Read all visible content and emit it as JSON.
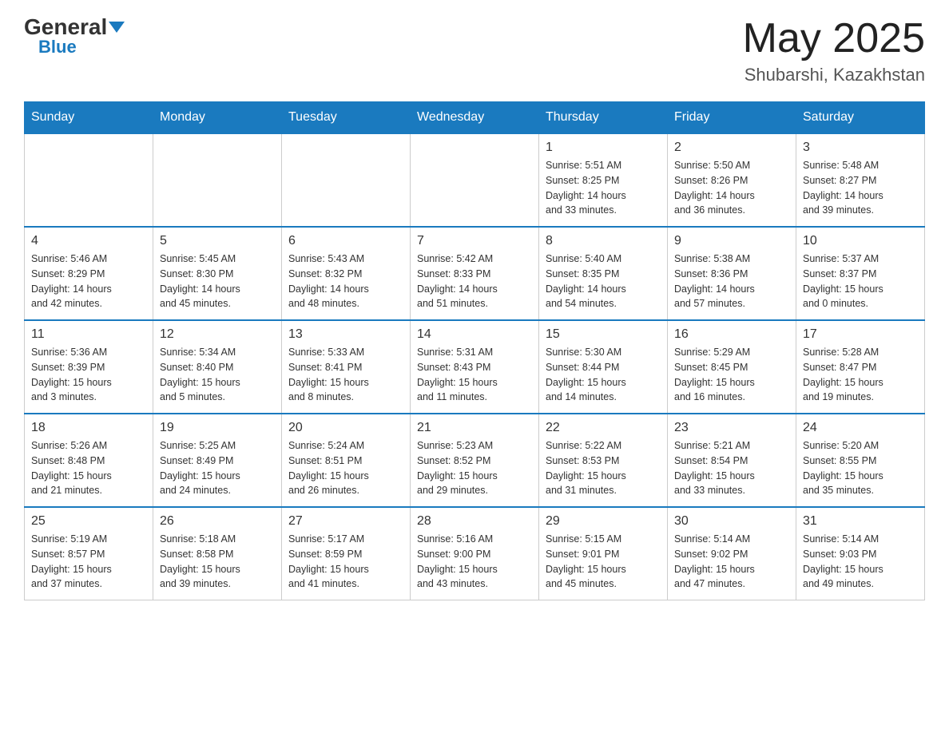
{
  "header": {
    "logo_general": "General",
    "logo_blue": "Blue",
    "month_year": "May 2025",
    "location": "Shubarshi, Kazakhstan"
  },
  "days_of_week": [
    "Sunday",
    "Monday",
    "Tuesday",
    "Wednesday",
    "Thursday",
    "Friday",
    "Saturday"
  ],
  "weeks": [
    [
      {
        "day": "",
        "info": ""
      },
      {
        "day": "",
        "info": ""
      },
      {
        "day": "",
        "info": ""
      },
      {
        "day": "",
        "info": ""
      },
      {
        "day": "1",
        "info": "Sunrise: 5:51 AM\nSunset: 8:25 PM\nDaylight: 14 hours\nand 33 minutes."
      },
      {
        "day": "2",
        "info": "Sunrise: 5:50 AM\nSunset: 8:26 PM\nDaylight: 14 hours\nand 36 minutes."
      },
      {
        "day": "3",
        "info": "Sunrise: 5:48 AM\nSunset: 8:27 PM\nDaylight: 14 hours\nand 39 minutes."
      }
    ],
    [
      {
        "day": "4",
        "info": "Sunrise: 5:46 AM\nSunset: 8:29 PM\nDaylight: 14 hours\nand 42 minutes."
      },
      {
        "day": "5",
        "info": "Sunrise: 5:45 AM\nSunset: 8:30 PM\nDaylight: 14 hours\nand 45 minutes."
      },
      {
        "day": "6",
        "info": "Sunrise: 5:43 AM\nSunset: 8:32 PM\nDaylight: 14 hours\nand 48 minutes."
      },
      {
        "day": "7",
        "info": "Sunrise: 5:42 AM\nSunset: 8:33 PM\nDaylight: 14 hours\nand 51 minutes."
      },
      {
        "day": "8",
        "info": "Sunrise: 5:40 AM\nSunset: 8:35 PM\nDaylight: 14 hours\nand 54 minutes."
      },
      {
        "day": "9",
        "info": "Sunrise: 5:38 AM\nSunset: 8:36 PM\nDaylight: 14 hours\nand 57 minutes."
      },
      {
        "day": "10",
        "info": "Sunrise: 5:37 AM\nSunset: 8:37 PM\nDaylight: 15 hours\nand 0 minutes."
      }
    ],
    [
      {
        "day": "11",
        "info": "Sunrise: 5:36 AM\nSunset: 8:39 PM\nDaylight: 15 hours\nand 3 minutes."
      },
      {
        "day": "12",
        "info": "Sunrise: 5:34 AM\nSunset: 8:40 PM\nDaylight: 15 hours\nand 5 minutes."
      },
      {
        "day": "13",
        "info": "Sunrise: 5:33 AM\nSunset: 8:41 PM\nDaylight: 15 hours\nand 8 minutes."
      },
      {
        "day": "14",
        "info": "Sunrise: 5:31 AM\nSunset: 8:43 PM\nDaylight: 15 hours\nand 11 minutes."
      },
      {
        "day": "15",
        "info": "Sunrise: 5:30 AM\nSunset: 8:44 PM\nDaylight: 15 hours\nand 14 minutes."
      },
      {
        "day": "16",
        "info": "Sunrise: 5:29 AM\nSunset: 8:45 PM\nDaylight: 15 hours\nand 16 minutes."
      },
      {
        "day": "17",
        "info": "Sunrise: 5:28 AM\nSunset: 8:47 PM\nDaylight: 15 hours\nand 19 minutes."
      }
    ],
    [
      {
        "day": "18",
        "info": "Sunrise: 5:26 AM\nSunset: 8:48 PM\nDaylight: 15 hours\nand 21 minutes."
      },
      {
        "day": "19",
        "info": "Sunrise: 5:25 AM\nSunset: 8:49 PM\nDaylight: 15 hours\nand 24 minutes."
      },
      {
        "day": "20",
        "info": "Sunrise: 5:24 AM\nSunset: 8:51 PM\nDaylight: 15 hours\nand 26 minutes."
      },
      {
        "day": "21",
        "info": "Sunrise: 5:23 AM\nSunset: 8:52 PM\nDaylight: 15 hours\nand 29 minutes."
      },
      {
        "day": "22",
        "info": "Sunrise: 5:22 AM\nSunset: 8:53 PM\nDaylight: 15 hours\nand 31 minutes."
      },
      {
        "day": "23",
        "info": "Sunrise: 5:21 AM\nSunset: 8:54 PM\nDaylight: 15 hours\nand 33 minutes."
      },
      {
        "day": "24",
        "info": "Sunrise: 5:20 AM\nSunset: 8:55 PM\nDaylight: 15 hours\nand 35 minutes."
      }
    ],
    [
      {
        "day": "25",
        "info": "Sunrise: 5:19 AM\nSunset: 8:57 PM\nDaylight: 15 hours\nand 37 minutes."
      },
      {
        "day": "26",
        "info": "Sunrise: 5:18 AM\nSunset: 8:58 PM\nDaylight: 15 hours\nand 39 minutes."
      },
      {
        "day": "27",
        "info": "Sunrise: 5:17 AM\nSunset: 8:59 PM\nDaylight: 15 hours\nand 41 minutes."
      },
      {
        "day": "28",
        "info": "Sunrise: 5:16 AM\nSunset: 9:00 PM\nDaylight: 15 hours\nand 43 minutes."
      },
      {
        "day": "29",
        "info": "Sunrise: 5:15 AM\nSunset: 9:01 PM\nDaylight: 15 hours\nand 45 minutes."
      },
      {
        "day": "30",
        "info": "Sunrise: 5:14 AM\nSunset: 9:02 PM\nDaylight: 15 hours\nand 47 minutes."
      },
      {
        "day": "31",
        "info": "Sunrise: 5:14 AM\nSunset: 9:03 PM\nDaylight: 15 hours\nand 49 minutes."
      }
    ]
  ]
}
